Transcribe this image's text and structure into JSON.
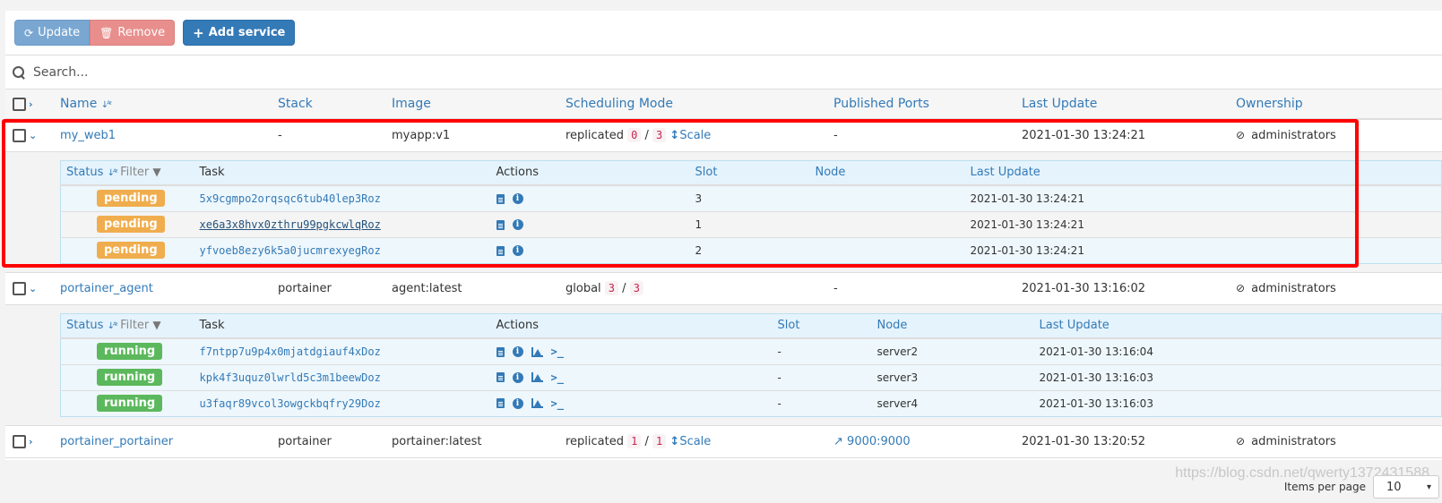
{
  "toolbar": {
    "update_label": "Update",
    "remove_label": "Remove",
    "add_label": "Add service",
    "update_icon": "⟳",
    "remove_icon": "🗑",
    "add_icon": "+"
  },
  "search": {
    "placeholder": "Search..."
  },
  "columns": {
    "name": "Name",
    "stack": "Stack",
    "image": "Image",
    "scheduling": "Scheduling Mode",
    "ports": "Published Ports",
    "last_update": "Last Update",
    "ownership": "Ownership"
  },
  "task_columns": {
    "status": "Status",
    "filter": "Filter",
    "task": "Task",
    "actions": "Actions",
    "slot": "Slot",
    "node": "Node",
    "last_update": "Last Update"
  },
  "services": [
    {
      "name": "my_web1",
      "stack": "-",
      "image": "myapp:v1",
      "mode": "replicated",
      "running": "0",
      "desired": "3",
      "scale_label": "Scale",
      "ports": "-",
      "last_update": "2021-01-30 13:24:21",
      "ownership": "administrators",
      "expanded": true,
      "tasks": [
        {
          "status": "pending",
          "id": "5x9cgmpo2orqsqc6tub40lep3Roz",
          "slot": "3",
          "node": "",
          "last_update": "2021-01-30 13:24:21"
        },
        {
          "status": "pending",
          "id": "xe6a3x8hvx0zthru99pgkcwlqRoz",
          "slot": "1",
          "node": "",
          "last_update": "2021-01-30 13:24:21"
        },
        {
          "status": "pending",
          "id": "yfvoeb8ezy6k5a0jucmrexyegRoz",
          "slot": "2",
          "node": "",
          "last_update": "2021-01-30 13:24:21"
        }
      ]
    },
    {
      "name": "portainer_agent",
      "stack": "portainer",
      "image": "agent:latest",
      "mode": "global",
      "running": "3",
      "desired": "3",
      "ports": "-",
      "last_update": "2021-01-30 13:16:02",
      "ownership": "administrators",
      "expanded": true,
      "tasks": [
        {
          "status": "running",
          "id": "f7ntpp7u9p4x0mjatdgiauf4xDoz",
          "slot": "-",
          "node": "server2",
          "last_update": "2021-01-30 13:16:04"
        },
        {
          "status": "running",
          "id": "kpk4f3uquz0lwrld5c3m1beewDoz",
          "slot": "-",
          "node": "server3",
          "last_update": "2021-01-30 13:16:03"
        },
        {
          "status": "running",
          "id": "u3faqr89vcol3owgckbqfry29Doz",
          "slot": "-",
          "node": "server4",
          "last_update": "2021-01-30 13:16:03"
        }
      ]
    },
    {
      "name": "portainer_portainer",
      "stack": "portainer",
      "image": "portainer:latest",
      "mode": "replicated",
      "running": "1",
      "desired": "1",
      "scale_label": "Scale",
      "ports": "9000:9000",
      "last_update": "2021-01-30 13:20:52",
      "ownership": "administrators",
      "expanded": false
    }
  ],
  "footer": {
    "items_per_page_label": "Items per page",
    "items_per_page_value": "10"
  },
  "watermark": "https://blog.csdn.net/qwerty1372431588",
  "colors": {
    "primary": "#337ab7",
    "pending": "#f0ad4e",
    "running": "#5cb85c",
    "danger_muted": "#e88f8d",
    "highlight": "#ff0000"
  }
}
